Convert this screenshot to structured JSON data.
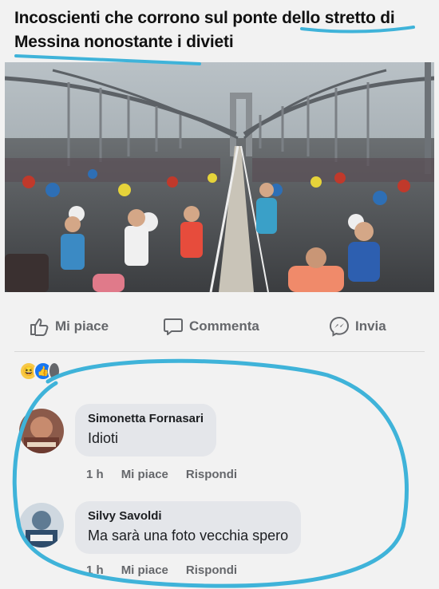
{
  "headline": {
    "text": "Incoscienti che corrono sul ponte dello stretto di Messina nonostante i divieti",
    "color": "#111111",
    "underline_color": "#3fb3d9"
  },
  "photo": {
    "description_icon": "marathon-bridge-photo"
  },
  "actions": {
    "like_label": "Mi piace",
    "comment_label": "Commenta",
    "share_label": "Invia"
  },
  "reactions": {
    "icons": [
      "haha-reaction-icon",
      "like-reaction-icon"
    ]
  },
  "comments": [
    {
      "author": "Simonetta Fornasari",
      "text": "Idioti",
      "time": "1 h",
      "like": "Mi piace",
      "reply": "Rispondi"
    },
    {
      "author": "Silvy Savoldi",
      "text": "Ma sarà una foto vecchia spero",
      "time": "1 h",
      "like": "Mi piace",
      "reply": "Rispondi"
    }
  ],
  "colors": {
    "background": "#f2f2f2",
    "bubble": "#e4e6ea",
    "muted_text": "#65676b",
    "highlight_oval": "#3fb3d9"
  }
}
